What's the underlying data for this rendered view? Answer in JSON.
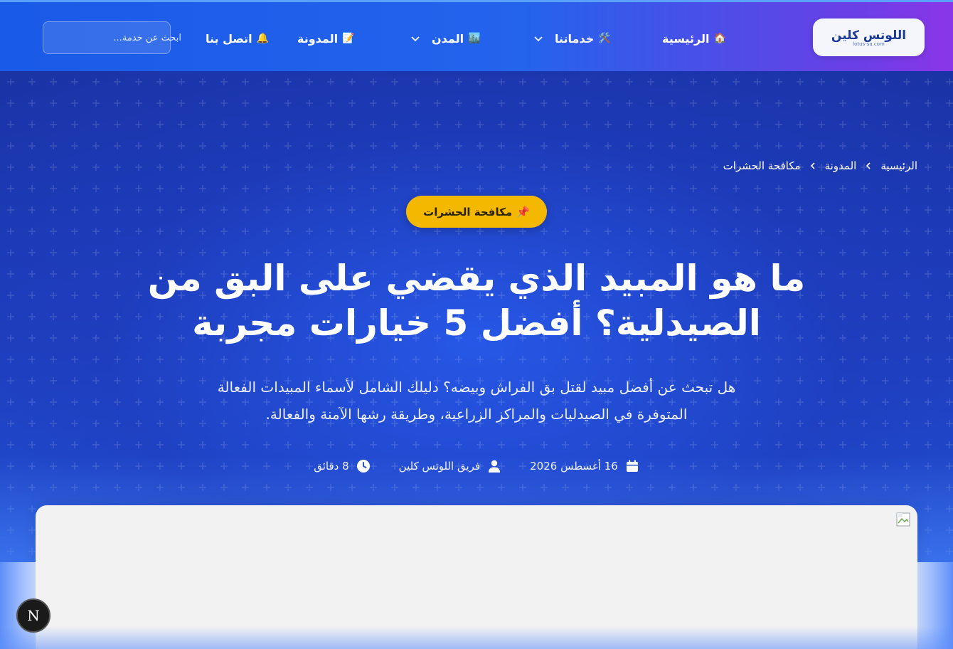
{
  "brand": {
    "logo_text": "اللوتس كلين",
    "logo_sub": "lotus-sa.com",
    "accent": "#1a5ae8",
    "badge_color": "#f5b800"
  },
  "nav": {
    "items": [
      {
        "label": "الرئيسية",
        "emoji": "🏠",
        "dropdown": false
      },
      {
        "label": "خدماتنا",
        "emoji": "🛠️",
        "dropdown": true
      },
      {
        "label": "المدن",
        "emoji": "🏙️",
        "dropdown": true
      },
      {
        "label": "المدونة",
        "emoji": "📝",
        "dropdown": false
      },
      {
        "label": "اتصل بنا",
        "emoji": "🔔",
        "dropdown": false
      }
    ],
    "search_placeholder": "ابحث عن خدمة..."
  },
  "breadcrumb": {
    "home": "الرئيسية",
    "blog": "المدونة",
    "current": "مكافحة الحشرات"
  },
  "article": {
    "category": "مكافحة الحشرات",
    "category_emoji": "📌",
    "title_line1": "ما هو المبيد الذي يقضي على البق من",
    "title_line2": "الصيدلية؟ أفضل 5 خيارات مجربة",
    "subtitle_line1": "هل تبحث عن أفضل مبيد لقتل بق الفراش وبيضه؟ دليلك الشامل لأسماء المبيدات الفعالة",
    "subtitle_line2": "المتوفرة في الصيدليات والمراكز الزراعية، وطريقة رشها الآمنة والفعالة.",
    "date": "16 أغسطس 2026",
    "author": "فريق اللوتس كلين",
    "read_time": "8 دقائق"
  },
  "dev_badge": "N"
}
